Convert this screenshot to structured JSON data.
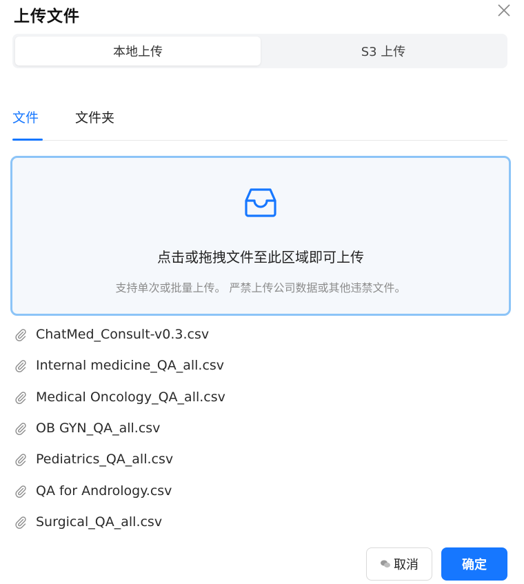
{
  "dialog": {
    "title": "上传文件"
  },
  "source_tabs": {
    "local": "本地上传",
    "s3": "S3 上传"
  },
  "type_tabs": [
    {
      "label": "文件",
      "active": true
    },
    {
      "label": "文件夹",
      "active": false
    }
  ],
  "dropzone": {
    "main_text": "点击或拖拽文件至此区域即可上传",
    "hint_text": "支持单次或批量上传。 严禁上传公司数据或其他违禁文件。"
  },
  "files": [
    "ChatMed_Consult-v0.3.csv",
    "Internal medicine_QA_all.csv",
    "Medical Oncology_QA_all.csv",
    "OB GYN_QA_all.csv",
    "Pediatrics_QA_all.csv",
    "QA for Andrology.csv",
    "Surgical_QA_all.csv"
  ],
  "footer": {
    "cancel_label": "取消",
    "ok_label": "确定"
  },
  "colors": {
    "accent": "#1677ff",
    "dropzone_border": "#8cc4f7",
    "dropzone_bg": "#f5f8fc",
    "segment_bg": "#f3f4f6"
  }
}
